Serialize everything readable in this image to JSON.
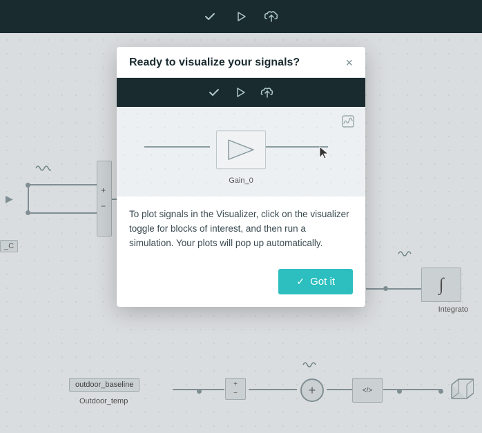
{
  "toolbar": {
    "check_icon": "✓",
    "play_icon": "▷",
    "upload_icon": "⬆"
  },
  "modal": {
    "title": "Ready to visualize your signals?",
    "close_label": "×",
    "mini_toolbar": {
      "check": "✓",
      "play": "▷",
      "upload": "⬆"
    },
    "gain_block_label": "Gain_0",
    "description": "To plot signals in the Visualizer, click on the visualizer toggle for blocks of interest, and then run a simulation. Your plots will pop up automatically.",
    "got_it_label": "Got it",
    "got_it_check": "✓"
  },
  "background": {
    "integrator_label": "Integrato",
    "integrator_symbol": "∫",
    "bottom_block_value": "outdoor_baseline",
    "bottom_block_label": "Outdoor_temp",
    "plus_symbol": "+",
    "minus_symbol": "−",
    "circle_plus": "+",
    "code_symbol": "</>",
    "arrow_left": "▶"
  }
}
